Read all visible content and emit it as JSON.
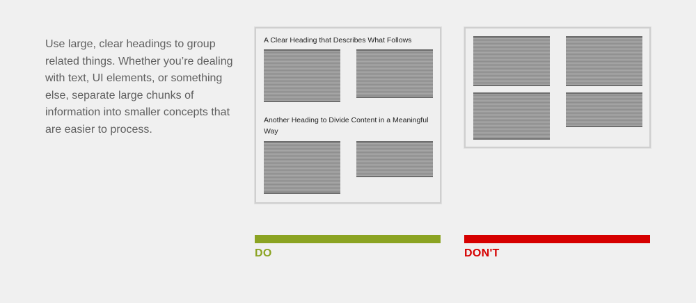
{
  "intro": {
    "text": "Use large, clear headings to group related things. Whether you’re dealing with text, UI elements, or something else, separate large chunks of information into smaller concepts that are easier to process."
  },
  "do_example": {
    "heading_1": "A Clear Heading that Describes What Follows",
    "heading_2": "Another Heading to Divide Content in a Meaningful Way",
    "label": "DO",
    "color": "#8ba322"
  },
  "dont_example": {
    "label": "DON'T",
    "color": "#d60000"
  }
}
